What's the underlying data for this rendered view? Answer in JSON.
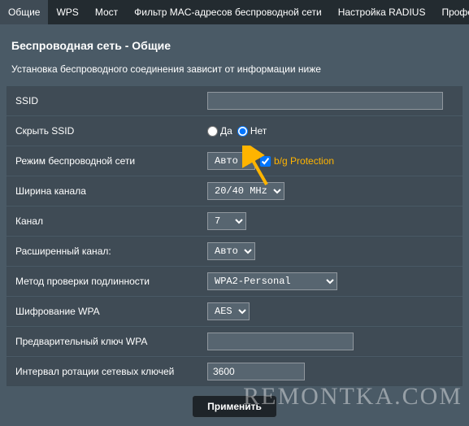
{
  "tabs": {
    "general": "Общие",
    "wps": "WPS",
    "bridge": "Мост",
    "macfilter": "Фильтр MAC-адресов беспроводной сети",
    "radius": "Настройка RADIUS",
    "prof": "Профе"
  },
  "page_title": "Беспроводная сеть - Общие",
  "subtitle": "Установка беспроводного соединения зависит от информации ниже",
  "labels": {
    "ssid": "SSID",
    "hide_ssid": "Скрыть SSID",
    "mode": "Режим беспроводной сети",
    "bandwidth": "Ширина канала",
    "channel": "Канал",
    "ext_channel": "Расширенный канал:",
    "auth": "Метод проверки подлинности",
    "cipher": "Шифрование WPA",
    "psk": "Предварительный ключ WPA",
    "rotation": "Интервал ротации сетевых ключей"
  },
  "values": {
    "ssid": "",
    "hide_yes": "Да",
    "hide_no": "Нет",
    "mode": "Авто",
    "bg_protection": "b/g Protection",
    "bandwidth": "20/40 MHz",
    "channel": "7",
    "ext_channel": "Авто",
    "auth": "WPA2-Personal",
    "cipher": "AES",
    "psk": "",
    "rotation": "3600"
  },
  "apply": "Применить",
  "watermark": "REMONTKA.COM"
}
